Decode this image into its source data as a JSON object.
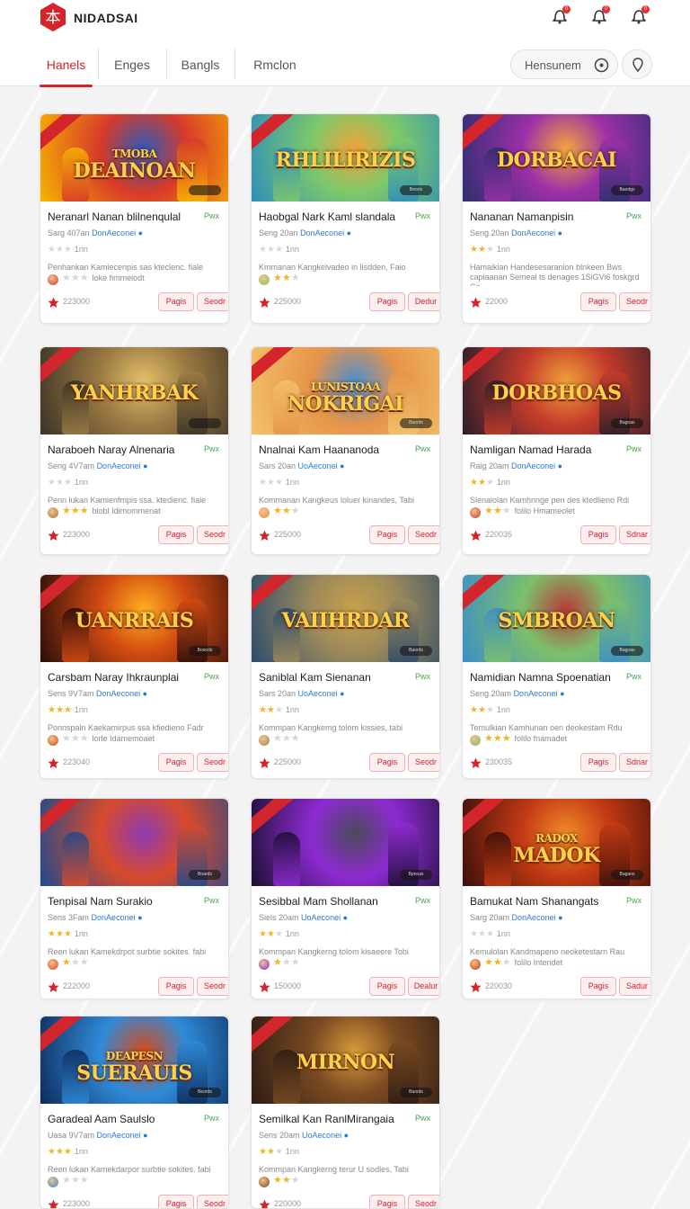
{
  "header": {
    "brand": "NIDADSAI",
    "logo_glyph": "本",
    "notifications": [
      {
        "icon": "bell-icon",
        "badge": "0"
      },
      {
        "icon": "bell-icon",
        "badge": "0"
      },
      {
        "icon": "bell-icon",
        "badge": "0"
      }
    ]
  },
  "tabs": [
    {
      "label": "Hanels",
      "active": true
    },
    {
      "label": "Enges",
      "active": false
    },
    {
      "label": "Bangls",
      "active": false
    },
    {
      "label": "Rmclon",
      "active": false
    }
  ],
  "search": {
    "placeholder": "Hensunem"
  },
  "colors": {
    "accent": "#d4242a",
    "tag_green": "#41a64a",
    "link_blue": "#2b7bd6",
    "star": "#f0b429"
  },
  "cards": [
    {
      "art_title": "DEAINOAN",
      "art_sub": "TMOBA",
      "badge": "",
      "title": "Neranarl Nanan blilnenqulal",
      "tag": "Pwx",
      "meta": "Sarg 407an",
      "meta_link": "DonAeconei",
      "rating_stars": 0,
      "rating_num": "1nn",
      "desc1": "Penhankan Kamiecenpis sas kteclenc. fiale",
      "desc2": "loke fimmeiodt",
      "desc_stars": 0,
      "count": "223000",
      "btn_a": "Pagis",
      "btn_b": "Seodr"
    },
    {
      "art_title": "RHLILIRIZIS",
      "art_sub": "",
      "badge": "Beorls",
      "title": "Haobgal Nark Kaml slandala",
      "tag": "Pwx",
      "meta": "Seng 20an",
      "meta_link": "DonAeconei",
      "rating_stars": 0,
      "rating_num": "1nn",
      "desc1": "Kmmanan Kangkelvadeo in lisdden, Faio",
      "desc2": "",
      "desc_stars": 2,
      "count": "225000",
      "btn_a": "Pagis",
      "btn_b": "Dedur"
    },
    {
      "art_title": "DORBACAI",
      "art_sub": "",
      "badge": "Baodgs",
      "title": "Nananan Namanpisin",
      "tag": "Pwx",
      "meta": "Seng 20an",
      "meta_link": "DonAeconei",
      "rating_stars": 2,
      "rating_num": "1nn",
      "desc1": "Hamaikian Handesesaranion blnkeen Bws",
      "desc2": "capiaanan Semeal ts denages 1SiGVi6 foskgrd Gs",
      "desc_stars": -1,
      "count": "22000",
      "btn_a": "Pagis",
      "btn_b": "Seodr"
    },
    {
      "art_title": "YANHRBAK",
      "art_sub": "",
      "badge": "",
      "title": "Naraboeh Naray Alnenaria",
      "tag": "Pwx",
      "meta": "Seng 4V7am",
      "meta_link": "DonAeconei",
      "rating_stars": 0,
      "rating_num": "1nn",
      "desc1": "Penn lukan Kamienfmpis ssa. ktedienc. fiale",
      "desc2": "blobl Idimommenat",
      "desc_stars": 4,
      "count": "223000",
      "btn_a": "Pagis",
      "btn_b": "Seodr"
    },
    {
      "art_title": "NOKRIGAI",
      "art_sub": "LUNISTOAA",
      "badge": "Baords",
      "title": "Nnalnai Kam Haananoda",
      "tag": "Pwx",
      "meta": "Sars 20an",
      "meta_link": "UoAeconei",
      "rating_stars": 0,
      "rating_num": "1nn",
      "desc1": "Kommanan Kangkeus loluer kinandes, Tabi",
      "desc2": "",
      "desc_stars": 2,
      "count": "225000",
      "btn_a": "Pagis",
      "btn_b": "Seodr"
    },
    {
      "art_title": "DORBHOAS",
      "art_sub": "",
      "badge": "Bagoas",
      "title": "Namligan Namad Harada",
      "tag": "Pwx",
      "meta": "Raig 20am",
      "meta_link": "DonAeconei",
      "rating_stars": 2,
      "rating_num": "1nn",
      "desc1": "Slenalolan Kamhnnge pen des ktedlieno Rdi",
      "desc2": "folilo Hmameolet",
      "desc_stars": 2,
      "count": "220035",
      "btn_a": "Pagis",
      "btn_b": "Sdnar"
    },
    {
      "art_title": "UANRRAIS",
      "art_sub": "",
      "badge": "Boocds",
      "title": "Carsbam Naray Ihkraunplai",
      "tag": "Pwx",
      "meta": "Sens 9V7am",
      "meta_link": "DonAeconei",
      "rating_stars": 3,
      "rating_num": "1nn",
      "desc1": "Ponnspaln Kaekamirpus ssa kfiedieno Fadr",
      "desc2": "lorle Idamemoaet",
      "desc_stars": 0,
      "count": "223040",
      "btn_a": "Pagis",
      "btn_b": "Seodr"
    },
    {
      "art_title": "VAIIHRDAR",
      "art_sub": "",
      "badge": "Baords",
      "title": "Saniblal Kam Sienanan",
      "tag": "Pwx",
      "meta": "Sars 20an",
      "meta_link": "UoAeconei",
      "rating_stars": 2,
      "rating_num": "1nn",
      "desc1": "Kommpan Kangkemg tolom kissies, tabi",
      "desc2": "",
      "desc_stars": 0,
      "count": "225000",
      "btn_a": "Pagis",
      "btn_b": "Seodr"
    },
    {
      "art_title": "SMBROAN",
      "art_sub": "",
      "badge": "Bagoas",
      "title": "Namidian Namna Spoenatian",
      "tag": "Pwx",
      "meta": "Seng 20am",
      "meta_link": "DonAeconei",
      "rating_stars": 2,
      "rating_num": "1nn",
      "desc1": "Temulkian Kamhunan oen deokestam Rdu",
      "desc2": "folilo fnamadet",
      "desc_stars": 3,
      "count": "230035",
      "btn_a": "Pagis",
      "btn_b": "Sdnar"
    },
    {
      "art_title": "",
      "art_sub": "",
      "badge": "Boards",
      "title": "Tenpisal Nam Surakio",
      "tag": "Pwx",
      "meta": "Sens 3Fam",
      "meta_link": "DonAeconei",
      "rating_stars": 3,
      "rating_num": "1nn",
      "desc1": "Reen lukan Kamekdrpot surbtie sokites. fabi",
      "desc2": "",
      "desc_stars": 1,
      "count": "222000",
      "btn_a": "Pagis",
      "btn_b": "Seodr"
    },
    {
      "art_title": "",
      "art_sub": "",
      "badge": "Bpnoas",
      "title": "Sesibbal Mam Shollanan",
      "tag": "Pwx",
      "meta": "Siels 20am",
      "meta_link": "UoAeconei",
      "rating_stars": 2,
      "rating_num": "1nn",
      "desc1": "Kommpan Kangkerng tolom kisaeere Tobi",
      "desc2": "",
      "desc_stars": 1,
      "count": "150000",
      "btn_a": "Pagis",
      "btn_b": "Dealur"
    },
    {
      "art_title": "MADOK",
      "art_sub": "RADOX",
      "badge": "Bagans",
      "title": "Bamukat Nam Shanangats",
      "tag": "Pwx",
      "meta": "Sarg 20am",
      "meta_link": "DonAeconei",
      "rating_stars": 0,
      "rating_num": "1nn",
      "desc1": "Kemulolan Kandmapeno neoketestarn Rau",
      "desc2": "folilo Intendet",
      "desc_stars": 2,
      "count": "220030",
      "btn_a": "Pagis",
      "btn_b": "Sadur"
    },
    {
      "art_title": "SUERAUIS",
      "art_sub": "DEAPESN",
      "badge": "Beords",
      "title": "Garadeal Aam Saulslo",
      "tag": "Pwx",
      "meta": "Uasa 9V7am",
      "meta_link": "DonAeconei",
      "rating_stars": 3,
      "rating_num": "1nn",
      "desc1": "Reen lukan Kamekdarpor surbtie sokites. fabi",
      "desc2": "",
      "desc_stars": 0,
      "count": "223000",
      "btn_a": "Pagis",
      "btn_b": "Seodr"
    },
    {
      "art_title": "MIRNON",
      "art_sub": "",
      "badge": "Baords",
      "title": "Semilkal Kan RanlMirangaia",
      "tag": "Pwx",
      "meta": "Sens 20am",
      "meta_link": "UoAeconei",
      "rating_stars": 2,
      "rating_num": "1nn",
      "desc1": "Kommpan Kangkerng terur U sodles, Tabi",
      "desc2": "",
      "desc_stars": 2,
      "count": "220000",
      "btn_a": "Pagis",
      "btn_b": "Seodr"
    }
  ]
}
